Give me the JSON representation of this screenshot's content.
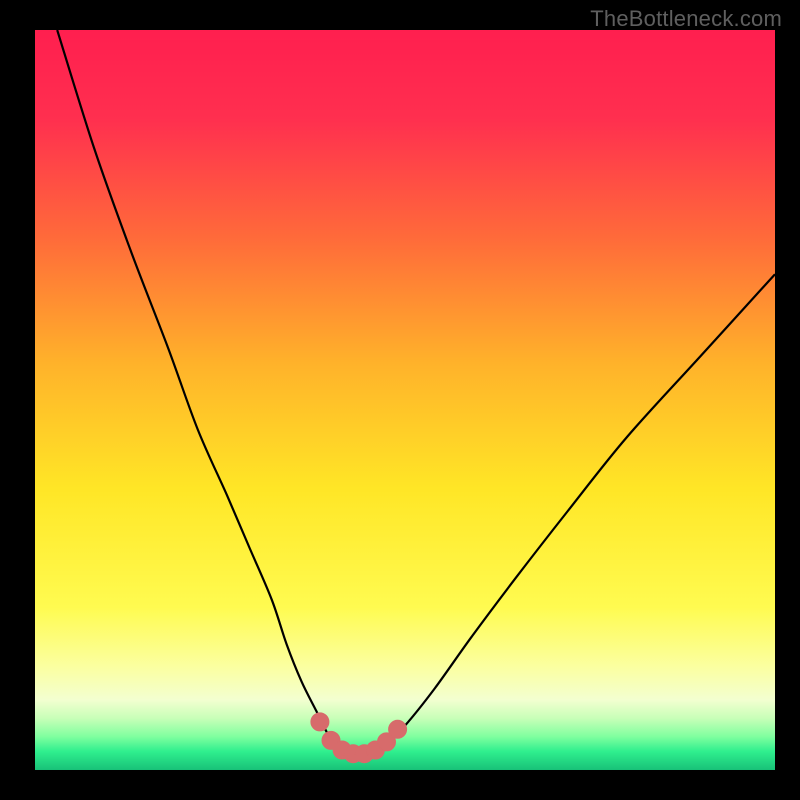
{
  "watermark": "TheBottleneck.com",
  "gradient_stops": [
    {
      "offset": 0.0,
      "color": "#ff1f4f"
    },
    {
      "offset": 0.12,
      "color": "#ff2f4f"
    },
    {
      "offset": 0.28,
      "color": "#ff6a3a"
    },
    {
      "offset": 0.45,
      "color": "#ffb22a"
    },
    {
      "offset": 0.62,
      "color": "#ffe626"
    },
    {
      "offset": 0.78,
      "color": "#fffb50"
    },
    {
      "offset": 0.86,
      "color": "#fbffa0"
    },
    {
      "offset": 0.905,
      "color": "#f3ffd0"
    },
    {
      "offset": 0.93,
      "color": "#c8ffb8"
    },
    {
      "offset": 0.955,
      "color": "#7fff9f"
    },
    {
      "offset": 0.975,
      "color": "#2fef8e"
    },
    {
      "offset": 1.0,
      "color": "#18c178"
    }
  ],
  "curve_color": "#000000",
  "curve_width": 2.2,
  "marker_color": "#d76b6b",
  "marker_stroke": "#d76b6b",
  "marker_radius": 9,
  "chart_data": {
    "type": "line",
    "title": "",
    "xlabel": "",
    "ylabel": "",
    "xlim": [
      0,
      100
    ],
    "ylim": [
      0,
      100
    ],
    "series": [
      {
        "name": "bottleneck-curve",
        "x": [
          3,
          8,
          13,
          18,
          22,
          26,
          29,
          32,
          34,
          36,
          38,
          39.5,
          41,
          43,
          45,
          47,
          50,
          54,
          59,
          65,
          72,
          80,
          90,
          100
        ],
        "y": [
          100,
          84,
          70,
          57,
          46,
          37,
          30,
          23,
          17,
          12,
          8,
          5,
          3,
          2,
          2,
          3,
          6,
          11,
          18,
          26,
          35,
          45,
          56,
          67
        ]
      }
    ],
    "markers": {
      "name": "highlighted-points",
      "x": [
        38.5,
        40,
        41.5,
        43,
        44.5,
        46,
        47.5,
        49
      ],
      "y": [
        6.5,
        4,
        2.7,
        2.2,
        2.2,
        2.7,
        3.8,
        5.5
      ]
    }
  }
}
